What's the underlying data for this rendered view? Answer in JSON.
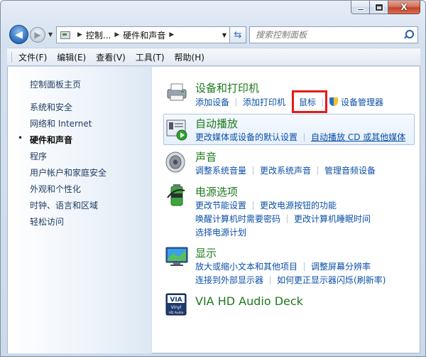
{
  "window": {
    "caption": {
      "minimize": "—",
      "maximize": "□",
      "close": "X"
    }
  },
  "address": {
    "crumbs": [
      "控制...",
      "硬件和声音"
    ],
    "search_placeholder": "搜索控制面板"
  },
  "menu": [
    "文件(F)",
    "编辑(E)",
    "查看(V)",
    "工具(T)",
    "帮助(H)"
  ],
  "sidebar": {
    "home": "控制面板主页",
    "items": [
      "系统和安全",
      "网络和 Internet",
      "硬件和声音",
      "程序",
      "用户帐户和家庭安全",
      "外观和个性化",
      "时钟、语言和区域",
      "轻松访问"
    ],
    "active_index": 2
  },
  "categories": {
    "devices": {
      "title": "设备和打印机",
      "links": [
        "添加设备",
        "添加打印机",
        "鼠标",
        "设备管理器"
      ]
    },
    "autoplay": {
      "title": "自动播放",
      "links": [
        "更改媒体或设备的默认设置",
        "自动播放 CD 或其他媒体"
      ]
    },
    "sound": {
      "title": "声音",
      "links": [
        "调整系统音量",
        "更改系统声音",
        "管理音频设备"
      ]
    },
    "power": {
      "title": "电源选项",
      "row1": [
        "更改节能设置",
        "更改电源按钮的功能"
      ],
      "row2": [
        "唤醒计算机时需要密码",
        "更改计算机睡眠时间"
      ],
      "row3": [
        "选择电源计划"
      ]
    },
    "display": {
      "title": "显示",
      "row1": [
        "放大或缩小文本和其他项目",
        "调整屏幕分辨率"
      ],
      "row2": [
        "连接到外部显示器",
        "如何更正显示器闪烁(刷新率)"
      ]
    },
    "via": {
      "title": "VIA HD Audio Deck",
      "logo_text": "VIA",
      "logo_sub": "Vinyl",
      "logo_tag": "HD Audio"
    }
  },
  "colors": {
    "category_title": "#1e7a1e",
    "link": "#0b4fa8",
    "highlight": "#e61919"
  }
}
